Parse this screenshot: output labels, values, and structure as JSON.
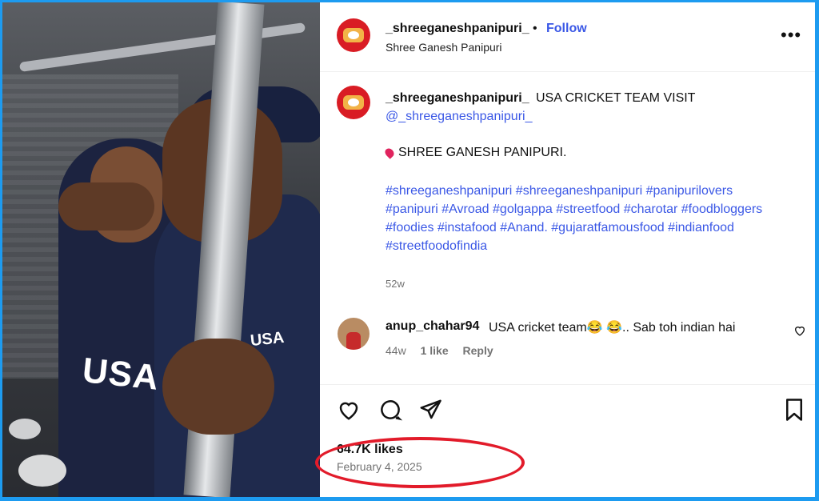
{
  "header": {
    "username": "_shreeganeshpanipuri_",
    "separator": "•",
    "follow_label": "Follow",
    "subtitle": "Shree Ganesh Panipuri",
    "more": "•••"
  },
  "caption": {
    "username": "_shreeganeshpanipuri_",
    "title": "USA CRICKET TEAM VISIT",
    "mention": "@_shreeganeshpanipuri_",
    "shop_line": "SHREE GANESH PANIPURI.",
    "hashtags": "#shreeganeshpanipuri #shreeganeshpanipuri #panipurilovers #panipuri #Avroad #golgappa #streetfood #charotar #foodbloggers #foodies #instafood #Anand. #gujaratfamousfood #indianfood #streetfoodofindia",
    "age": "52w"
  },
  "comment": {
    "username": "anup_chahar94",
    "text": "USA cricket team😂 😂.. Sab toh indian hai",
    "age": "44w",
    "likes": "1 like",
    "reply": "Reply"
  },
  "media": {
    "jersey_text": "USA",
    "jersey_text_2": "USA"
  },
  "footer": {
    "likes": "64.7K likes",
    "date": "February 4, 2025"
  },
  "icons": [
    "heart-icon",
    "comment-icon",
    "share-icon",
    "bookmark-icon",
    "more-icon"
  ],
  "colors": {
    "accent": "#3b58e6",
    "highlight": "#e21b2a",
    "border": "#1d9bf0"
  }
}
